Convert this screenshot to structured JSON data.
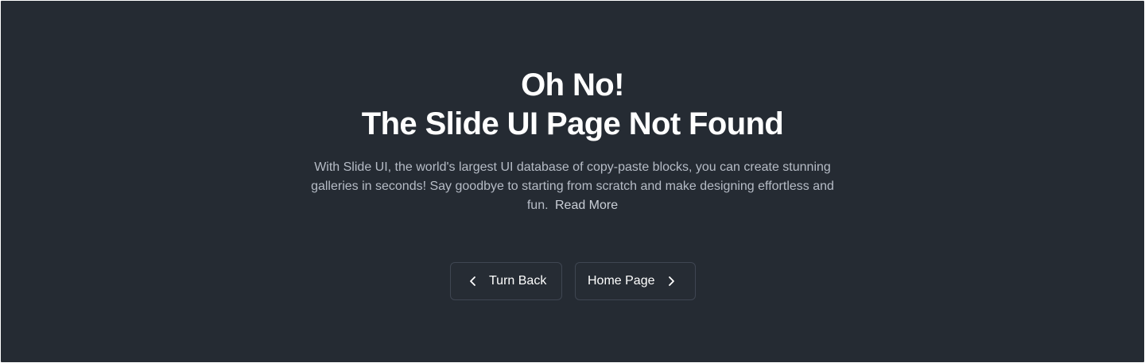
{
  "page": {
    "heading_line1": "Oh No!",
    "heading_line2": "The Slide UI Page Not Found",
    "description": "With Slide UI, the world's largest UI database of copy-paste blocks, you can create stunning galleries in seconds! Say goodbye to starting from scratch and make designing effortless and fun.",
    "read_more": "Read More"
  },
  "actions": {
    "back_label": "Turn Back",
    "back_icon": "chevron-left-icon",
    "home_label": "Home Page",
    "home_icon": "chevron-right-icon"
  },
  "colors": {
    "background": "#252b33",
    "heading": "#ffffff",
    "body_text": "#b6bcc6",
    "button_border": "#3f4652"
  }
}
